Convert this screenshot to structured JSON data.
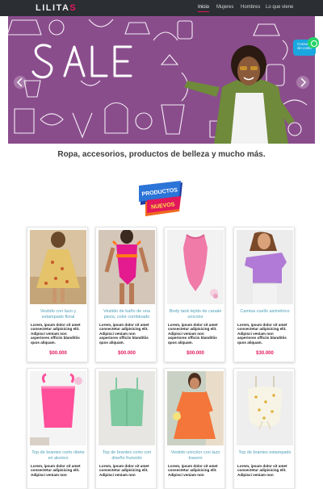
{
  "brand": {
    "name_main": "LILITA",
    "name_accent": "S",
    "accent_color": "#e2185b"
  },
  "nav": {
    "items": [
      {
        "label": "Inicio",
        "active": true
      },
      {
        "label": "Mujeres"
      },
      {
        "label": "Hombres"
      },
      {
        "label": "Lo que viene"
      }
    ]
  },
  "hero": {
    "sale_text": "SALE",
    "bg_color": "#8a4d8c"
  },
  "chat": {
    "label": "Consultá sin costo"
  },
  "tagline": "Ropa, accesorios, productos de belleza y mucho más.",
  "badge": {
    "line1": "PRODUCTOS",
    "line2": "NUEVOS"
  },
  "products": [
    {
      "name": "Vestido con lazo y estampado floral",
      "desc": "Lorem, ipsum dolor sit amet consectetur adipisicing elit. Adipisci veniam non asperiores officiis blanditiis quos aliquam.",
      "price": "$00.000",
      "icon": "floral-dress"
    },
    {
      "name": "Vestido de baño de una pieza, color combinado",
      "desc": "Lorem, ipsum dolor sit amet consectetur adipisicing elit. Adipisci veniam non asperiores officiis blanditiis quos aliquam.",
      "price": "$00.000",
      "icon": "swimsuit"
    },
    {
      "name": "Body tank tejido de canale unicolor",
      "desc": "Lorem, ipsum dolor sit amet consectetur adipisicing elit. Adipisci veniam non asperiores officiis blanditiis quos aliquam.",
      "price": "$00.000",
      "icon": "bodysuit"
    },
    {
      "name": "Camisa cuello asimétrico",
      "desc": "Lorem, ipsum dolor sit amet consectetur adipisicing elit. Adipisci veniam non asperiores officiis blanditiis quos aliquam.",
      "price": "$30.000",
      "icon": "asymmetric-top"
    },
    {
      "name": "Top de brantes corto ribete en alunico",
      "desc": "Lorem, ipsum dolor sit amet consectetur adipisicing elit. Adipisci veniam non",
      "icon": "pink-top"
    },
    {
      "name": "Top de brantes corto con diseño fruncido",
      "desc": "Lorem, ipsum dolor sit amet consectetur adipisicing elit. Adipisci veniam non",
      "icon": "green-top"
    },
    {
      "name": "Vestido unicolor con lazo trasero",
      "desc": "Lorem, ipsum dolor sit amet consectetur adipisicing elit. Adipisci veniam non",
      "icon": "orange-dress"
    },
    {
      "name": "Top de brantes estampado",
      "desc": "Lorem, ipsum dolor sit amet consectetur adipisicing elit. Adipisci veniam non",
      "icon": "printed-top"
    }
  ]
}
